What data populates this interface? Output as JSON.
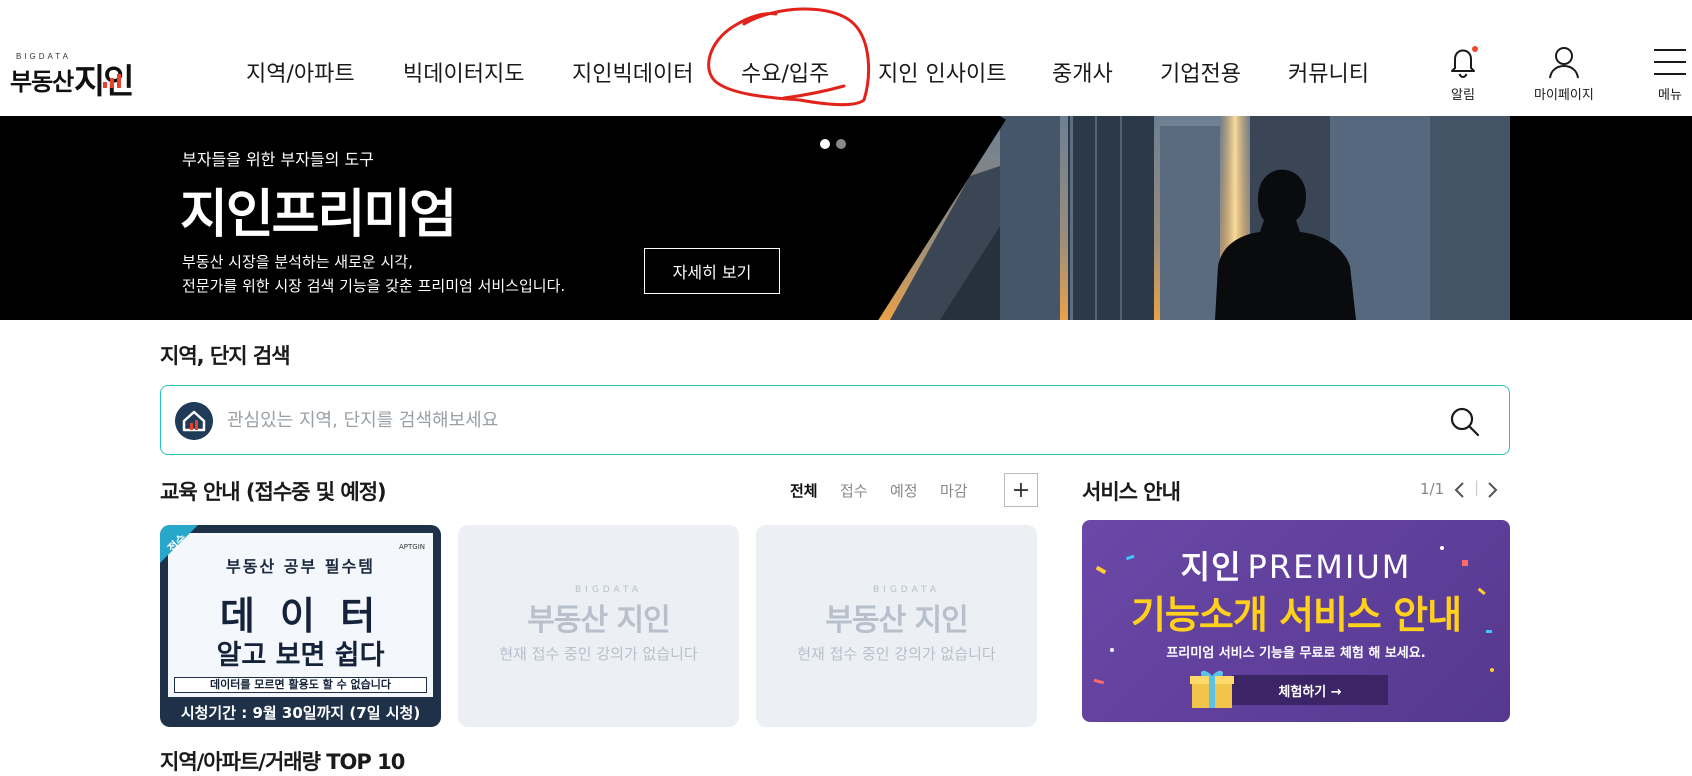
{
  "header": {
    "logo": {
      "small": "BIGDATA",
      "main": "부동산",
      "brand": "지인"
    },
    "nav": [
      {
        "label": "지역/아파트"
      },
      {
        "label": "빅데이터지도"
      },
      {
        "label": "지인빅데이터"
      },
      {
        "label": "수요/입주"
      },
      {
        "label": "지인 인사이트"
      },
      {
        "label": "중개사"
      },
      {
        "label": "기업전용"
      },
      {
        "label": "커뮤니티"
      }
    ],
    "utils": {
      "alarm": "알림",
      "mypage": "마이페이지",
      "menu": "메뉴"
    }
  },
  "banner": {
    "subtitle": "부자들을 위한 부자들의 도구",
    "title": "지인프리미엄",
    "desc_line1": "부동산 시장을 분석하는 새로운 시각,",
    "desc_line2": "전문가를 위한 시장 검색 기능을 갖춘 프리미엄 서비스입니다.",
    "button": "자세히 보기"
  },
  "search": {
    "title": "지역, 단지 검색",
    "placeholder": "관심있는 지역, 단지를 검색해보세요"
  },
  "education": {
    "title": "교육 안내 (접수중 및 예정)",
    "filters": [
      "전체",
      "접수",
      "예정",
      "마감"
    ],
    "plus": "+",
    "featured": {
      "badge": "접수",
      "tag": "APTGIN",
      "top": "부동산 공부 필수템",
      "main": "데 이 터",
      "sub": "알고 보면 쉽다",
      "strip": "데이터를 모르면 활용도 할 수 없습니다",
      "period": "시청기간 : 9월 30일까지 (7일 시청)"
    },
    "empty": {
      "small": "BIGDATA",
      "brand": "부동산 지인",
      "text": "현재 접수 중인 강의가 없습니다"
    }
  },
  "service": {
    "title": "서비스 안내",
    "pager": "1/1",
    "card": {
      "brand_bold": "지인",
      "brand_light": "PREMIUM",
      "headline": "기능소개 서비스 안내",
      "desc": "프리미엄 서비스 기능을 무료로 체험 해 보세요.",
      "button": "체험하기 →"
    }
  },
  "ranking": {
    "title": "지역/아파트/거래량 TOP 10"
  },
  "colors": {
    "accent": "#27c2c2",
    "brand_red": "#e8422e",
    "navy": "#1e3148",
    "purple": "#6b48a8",
    "yellow": "#ffd11a"
  }
}
